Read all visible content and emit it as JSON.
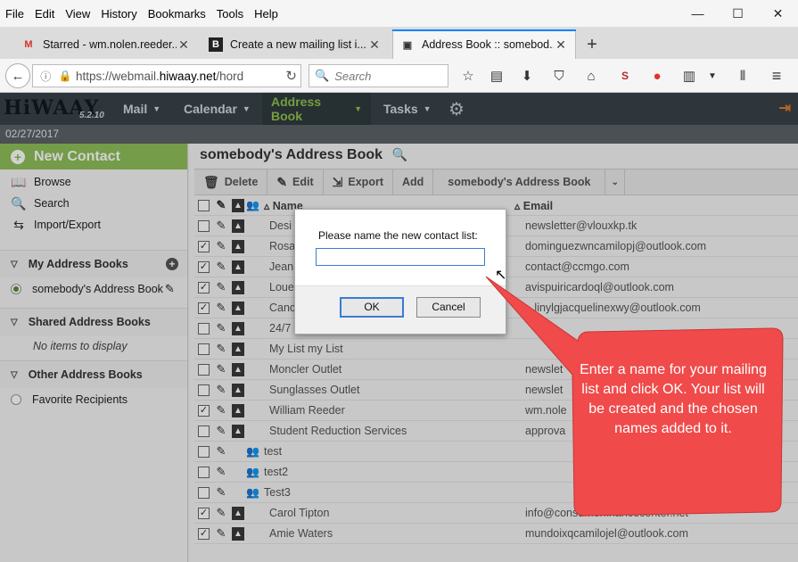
{
  "menubar": [
    "File",
    "Edit",
    "View",
    "History",
    "Bookmarks",
    "Tools",
    "Help"
  ],
  "tabs": [
    {
      "icon": "gmail-icon",
      "glyph": "M",
      "title": "Starred - wm.nolen.reeder..."
    },
    {
      "icon": "b-icon",
      "glyph": "B",
      "title": "Create a new mailing list i..."
    },
    {
      "icon": "address-book-icon",
      "glyph": "▣",
      "title": "Address Book :: somebod..."
    }
  ],
  "navbar": {
    "url_prefix": "https://webmail.",
    "url_domain": "hiwaay.net",
    "url_suffix": "/hord",
    "search_placeholder": "Search"
  },
  "horde": {
    "logo": "HiWAAY",
    "version": "5.2.10",
    "menus": [
      "Mail",
      "Calendar",
      "Address Book",
      "Tasks"
    ],
    "date": "02/27/2017"
  },
  "sidebar": {
    "new_contact": "New Contact",
    "nav": [
      "Browse",
      "Search",
      "Import/Export"
    ],
    "my_books_header": "My Address Books",
    "my_book": "somebody's Address Book",
    "shared_header": "Shared Address Books",
    "shared_empty": "No items to display",
    "other_header": "Other Address Books",
    "other_book": "Favorite Recipients"
  },
  "main": {
    "title": "somebody's Address Book",
    "toolbar": {
      "delete": "Delete",
      "edit": "Edit",
      "export": "Export",
      "add": "Add",
      "target": "somebody's Address Book"
    },
    "columns": {
      "name": "Name",
      "email": "Email"
    },
    "rows": [
      {
        "checked": false,
        "type": "person",
        "name": "Desi",
        "email": "newsletter@vlouxkp.tk"
      },
      {
        "checked": true,
        "type": "person",
        "name": "Rosa",
        "email": "dominguezwncamilopj@outlook.com"
      },
      {
        "checked": true,
        "type": "person",
        "name": "Jean",
        "email": "contact@ccmgo.com"
      },
      {
        "checked": true,
        "type": "person",
        "name": "Loue",
        "email": "avispuiricardoql@outlook.com"
      },
      {
        "checked": true,
        "type": "person",
        "name": "Canc",
        "email": "...linylgjacquelinexwy@outlook.com"
      },
      {
        "checked": false,
        "type": "person",
        "name": "24/7",
        "email": ""
      },
      {
        "checked": false,
        "type": "person",
        "name": "My List my List",
        "email": ""
      },
      {
        "checked": false,
        "type": "person",
        "name": "Moncler Outlet",
        "email": "newslet"
      },
      {
        "checked": false,
        "type": "person",
        "name": "Sunglasses Outlet",
        "email": "newslet"
      },
      {
        "checked": true,
        "type": "person",
        "name": "William Reeder",
        "email": "wm.nole"
      },
      {
        "checked": false,
        "type": "person",
        "name": "Student Reduction Services",
        "email": "approva"
      },
      {
        "checked": false,
        "type": "group",
        "name": "test",
        "email": ""
      },
      {
        "checked": false,
        "type": "group",
        "name": "test2",
        "email": ""
      },
      {
        "checked": false,
        "type": "group",
        "name": "Test3",
        "email": ""
      },
      {
        "checked": true,
        "type": "person",
        "name": "Carol Tipton",
        "email": "info@consumerfinancecenter.net"
      },
      {
        "checked": true,
        "type": "person",
        "name": "Amie Waters",
        "email": "mundoixqcamilojel@outlook.com"
      }
    ]
  },
  "dialog": {
    "prompt": "Please name the new contact list:",
    "value": "",
    "ok": "OK",
    "cancel": "Cancel"
  },
  "callout": {
    "text": "Enter a name for your mailing list and click OK. Your list will be created and the chosen names added to it.",
    "color": "#f04a4a"
  }
}
